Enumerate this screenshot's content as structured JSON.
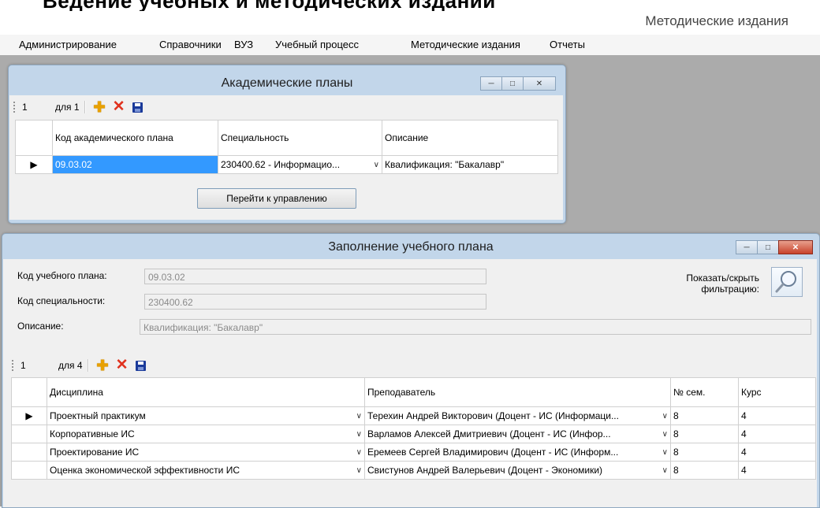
{
  "top_caption": "Ведение учебных и методических изданий",
  "main_window": {
    "title": "Методические издания"
  },
  "menu": [
    "Администрирование",
    "Справочники",
    "ВУЗ",
    "Учебный процесс",
    "Методические издания",
    "Отчеты"
  ],
  "academic_plans": {
    "title": "Академические планы",
    "toolbar": {
      "position": "1",
      "count": "для 1"
    },
    "columns": [
      "Код академического плана",
      "Специальность",
      "Описание"
    ],
    "rows": [
      {
        "code": "09.03.02",
        "specialty": "230400.62 - Информацио...",
        "description": "Квалификация: \"Бакалавр\""
      }
    ],
    "manage_button": "Перейти к управлению"
  },
  "curriculum": {
    "title": "Заполнение учебного плана",
    "fields": {
      "plan_code_label": "Код учебного плана:",
      "plan_code_value": "09.03.02",
      "specialty_code_label": "Код специальности:",
      "specialty_code_value": "230400.62",
      "description_label": "Описание:",
      "description_value": "Квалификация: \"Бакалавр\""
    },
    "filter_label": "Показать/скрыть фильтрацию:",
    "toolbar": {
      "position": "1",
      "count": "для 4"
    },
    "columns": [
      "Дисциплина",
      "Преподаватель",
      "№ сем.",
      "Курс"
    ],
    "rows": [
      {
        "discipline": "Проектный практикум",
        "teacher": "Терехин Андрей Викторович (Доцент - ИС (Информаци...",
        "semester": "8",
        "course": "4"
      },
      {
        "discipline": "Корпоративные ИС",
        "teacher": "Варламов Алексей Дмитриевич (Доцент - ИС (Инфор...",
        "semester": "8",
        "course": "4"
      },
      {
        "discipline": "Проектирование ИС",
        "teacher": "Еремеев Сергей Владимирович (Доцент - ИС (Информ...",
        "semester": "8",
        "course": "4"
      },
      {
        "discipline": "Оценка экономической эффективности ИС",
        "teacher": "Свистунов Андрей Валерьевич (Доцент - Экономики)",
        "semester": "8",
        "course": "4"
      }
    ]
  },
  "colors": {
    "selection": "#3399ff",
    "window_frame": "#c2d6ea",
    "mdi_background": "#ababab",
    "close_button": "#c8422a"
  },
  "icons": [
    "add-icon",
    "delete-icon",
    "save-icon",
    "search-icon",
    "minimize-icon",
    "maximize-icon",
    "close-icon",
    "row-pointer-icon",
    "chevron-down-icon"
  ]
}
